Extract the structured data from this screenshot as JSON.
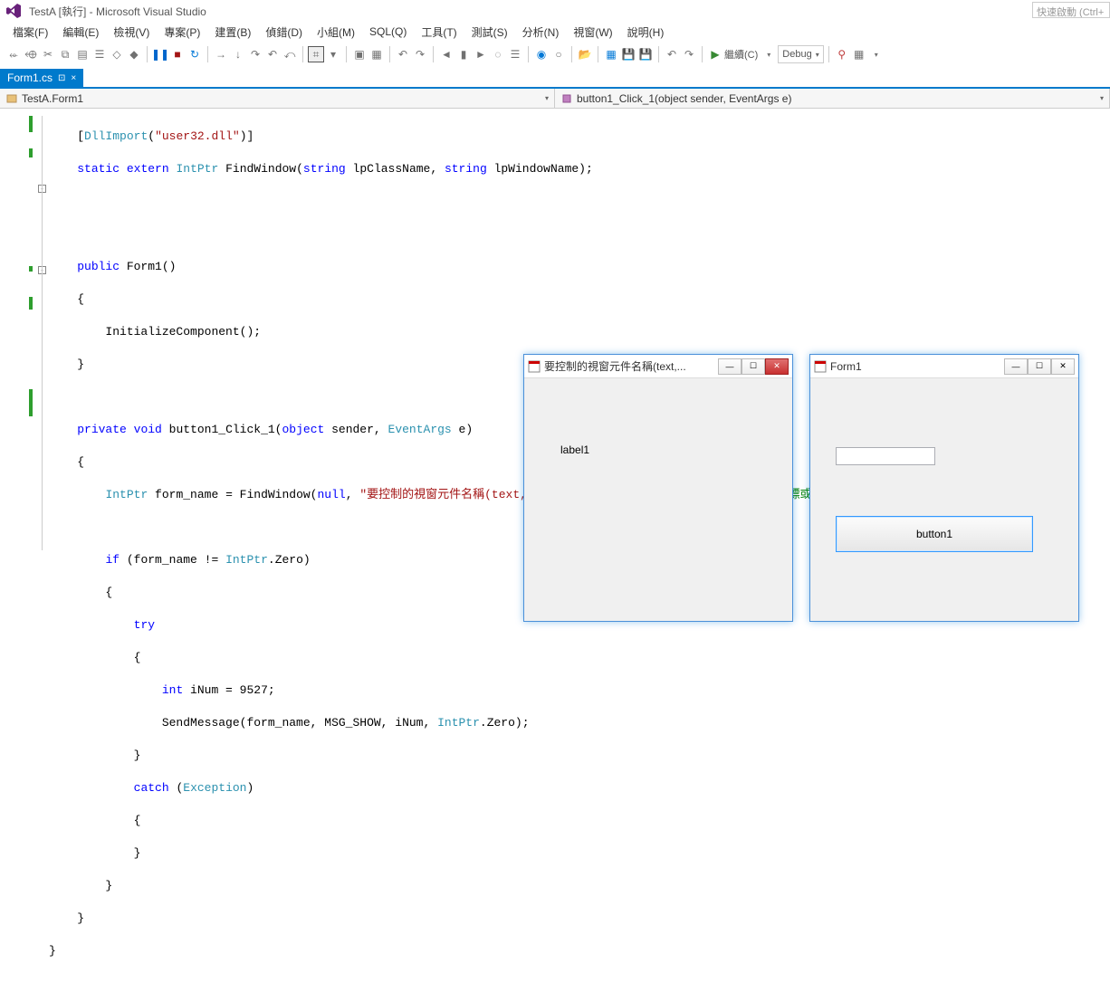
{
  "titlebar": {
    "title": "TestA [執行] - Microsoft Visual Studio"
  },
  "quick_launch_placeholder": "快速啟動 (Ctrl+",
  "menu": {
    "file": "檔案(F)",
    "edit": "編輯(E)",
    "view": "檢視(V)",
    "project": "專案(P)",
    "build": "建置(B)",
    "debug": "偵錯(D)",
    "team": "小組(M)",
    "sql": "SQL(Q)",
    "tools": "工具(T)",
    "test": "測試(S)",
    "analyze": "分析(N)",
    "window": "視窗(W)",
    "help": "說明(H)"
  },
  "toolbar": {
    "continue_label": "繼續(C)",
    "config_label": "Debug"
  },
  "doc_tab": {
    "name": "Form1.cs",
    "pin": "⊡",
    "close": "×"
  },
  "nav": {
    "left": "TestA.Form1",
    "right": "button1_Click_1(object sender, EventArgs e)"
  },
  "code": {
    "l1_a": "[",
    "l1_b": "DllImport",
    "l1_c": "(",
    "l1_d": "\"user32.dll\"",
    "l1_e": ")]",
    "l2_a": "static",
    "l2_b": "extern",
    "l2_c": "IntPtr",
    "l2_d": "FindWindow(",
    "l2_e": "string",
    "l2_f": " lpClassName, ",
    "l2_g": "string",
    "l2_h": " lpWindowName);",
    "l3_a": "public",
    "l3_b": " Form1()",
    "l4": "{",
    "l5": "    InitializeComponent();",
    "l6": "}",
    "l7_a": "private",
    "l7_b": "void",
    "l7_c": " button1_Click_1(",
    "l7_d": "object",
    "l7_e": " sender, ",
    "l7_f": "EventArgs",
    "l7_g": " e)",
    "l8": "{",
    "l9_a": "    ",
    "l9_b": "IntPtr",
    "l9_c": " form_name = FindWindow(",
    "l9_d": "null",
    "l9_e": ", ",
    "l9_f": "\"要控制的視窗元件名稱(text,不是name)\"",
    "l9_g": ");",
    "l9_h": "//找TestB的IntPtr 用來代表指標或控制代碼",
    "l10_a": "    ",
    "l10_b": "if",
    "l10_c": " (form_name != ",
    "l10_d": "IntPtr",
    "l10_e": ".Zero)",
    "l11": "    {",
    "l12_a": "        ",
    "l12_b": "try",
    "l13": "        {",
    "l14_a": "            ",
    "l14_b": "int",
    "l14_c": " iNum = 9527;",
    "l15_a": "            SendMessage(form_name, MSG_SHOW, iNum, ",
    "l15_b": "IntPtr",
    "l15_c": ".Zero);",
    "l16": "        }",
    "l17_a": "        ",
    "l17_b": "catch",
    "l17_c": " (",
    "l17_d": "Exception",
    "l17_e": ")",
    "l18": "        {",
    "l19": "        }",
    "l20": "    }",
    "l21": "}",
    "l22": "}"
  },
  "winA": {
    "title": "要控制的視窗元件名稱(text,...",
    "label": "label1"
  },
  "winB": {
    "title": "Form1",
    "button": "button1"
  }
}
